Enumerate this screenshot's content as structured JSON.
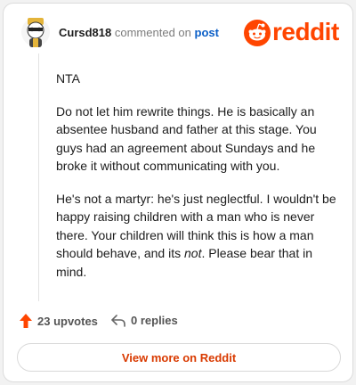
{
  "header": {
    "username": "Cursd818",
    "commented_text": "commented on",
    "post_link": "post",
    "logo_text": "reddit"
  },
  "comment": {
    "paragraphs": [
      "NTA",
      "Do not let him rewrite things. He is basically an absentee husband and father at this stage. You guys had an agreement about Sundays and he broke it without communicating with you.",
      "He's not a martyr: he's just neglectful. I wouldn't be happy raising children with a man who is never there. Your children will think this is how a man should behave, and its",
      "not",
      ". Please bear that in mind."
    ]
  },
  "footer": {
    "upvotes": "23 upvotes",
    "replies": "0 replies"
  },
  "cta": {
    "label": "View more on Reddit"
  },
  "colors": {
    "brand": "#ff4500",
    "link": "#0b5fc7",
    "cta_text": "#d93a00"
  }
}
